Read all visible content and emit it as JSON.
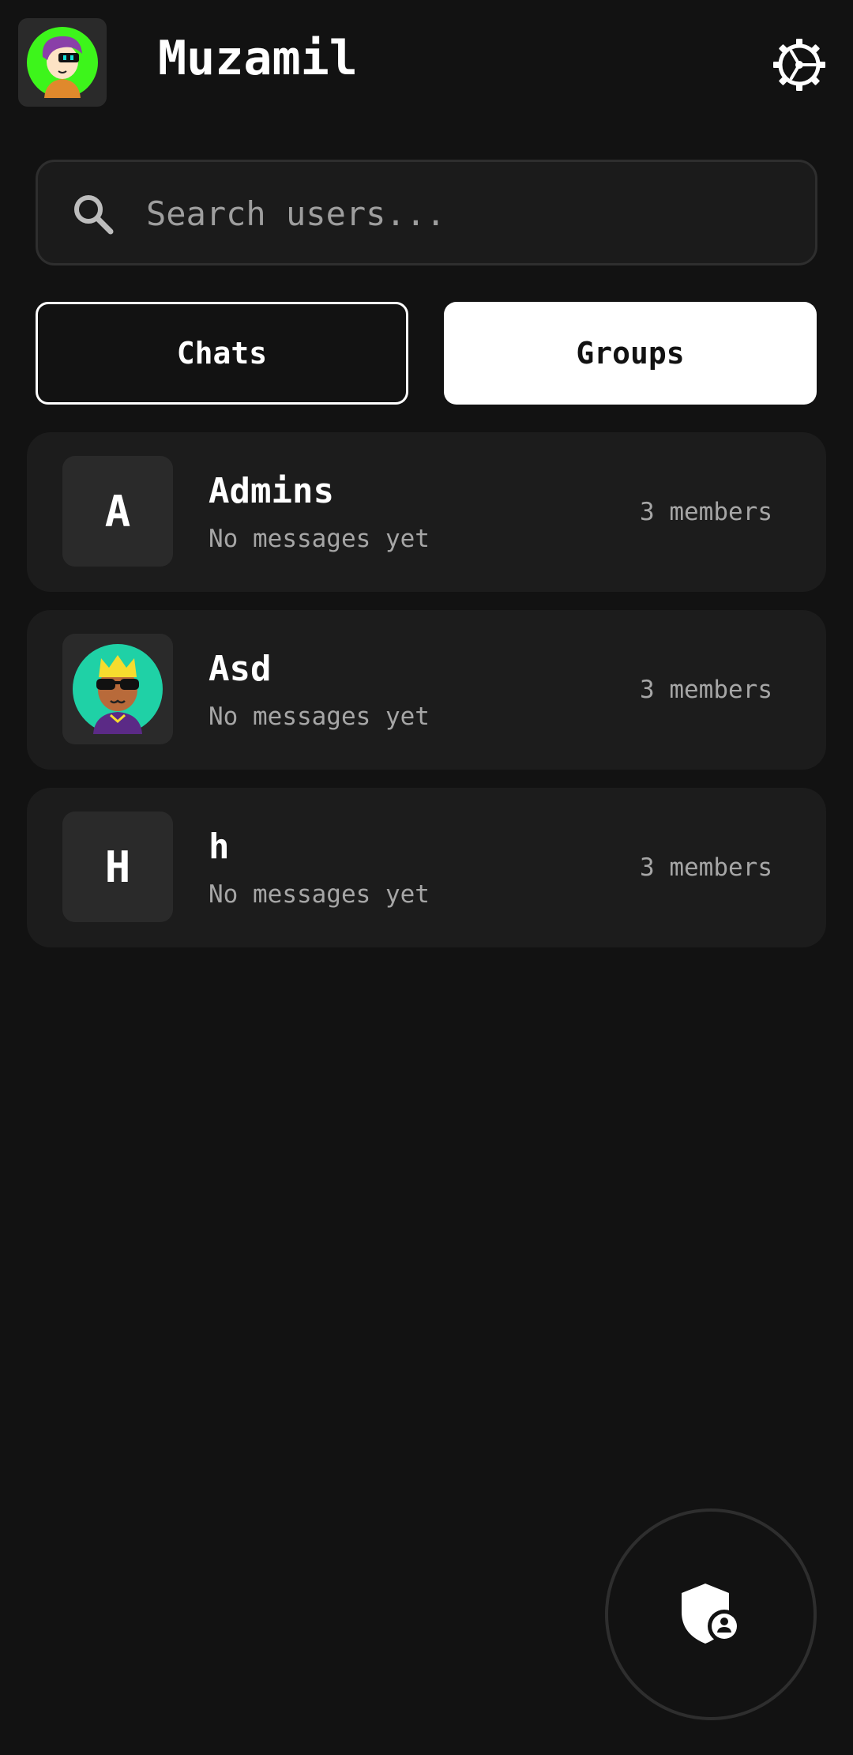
{
  "header": {
    "user_name": "Muzamil",
    "avatar_icon": "user-avatar-icon",
    "settings_icon": "gear-icon"
  },
  "search": {
    "placeholder": "Search users..."
  },
  "tabs": {
    "chats_label": "Chats",
    "groups_label": "Groups",
    "active": "Groups"
  },
  "groups": [
    {
      "initial": "A",
      "name": "Admins",
      "last_message": "No messages yet",
      "members": "3 members"
    },
    {
      "initial": "",
      "name": "Asd",
      "last_message": "No messages yet",
      "members": "3 members"
    },
    {
      "initial": "H",
      "name": "h",
      "last_message": "No messages yet",
      "members": "3 members"
    }
  ],
  "fab": {
    "icon": "admin-shield-icon"
  },
  "colors": {
    "background": "#121212",
    "card": "#1c1c1c",
    "accent": "#ffffff",
    "muted_text": "#a6a6a6"
  }
}
